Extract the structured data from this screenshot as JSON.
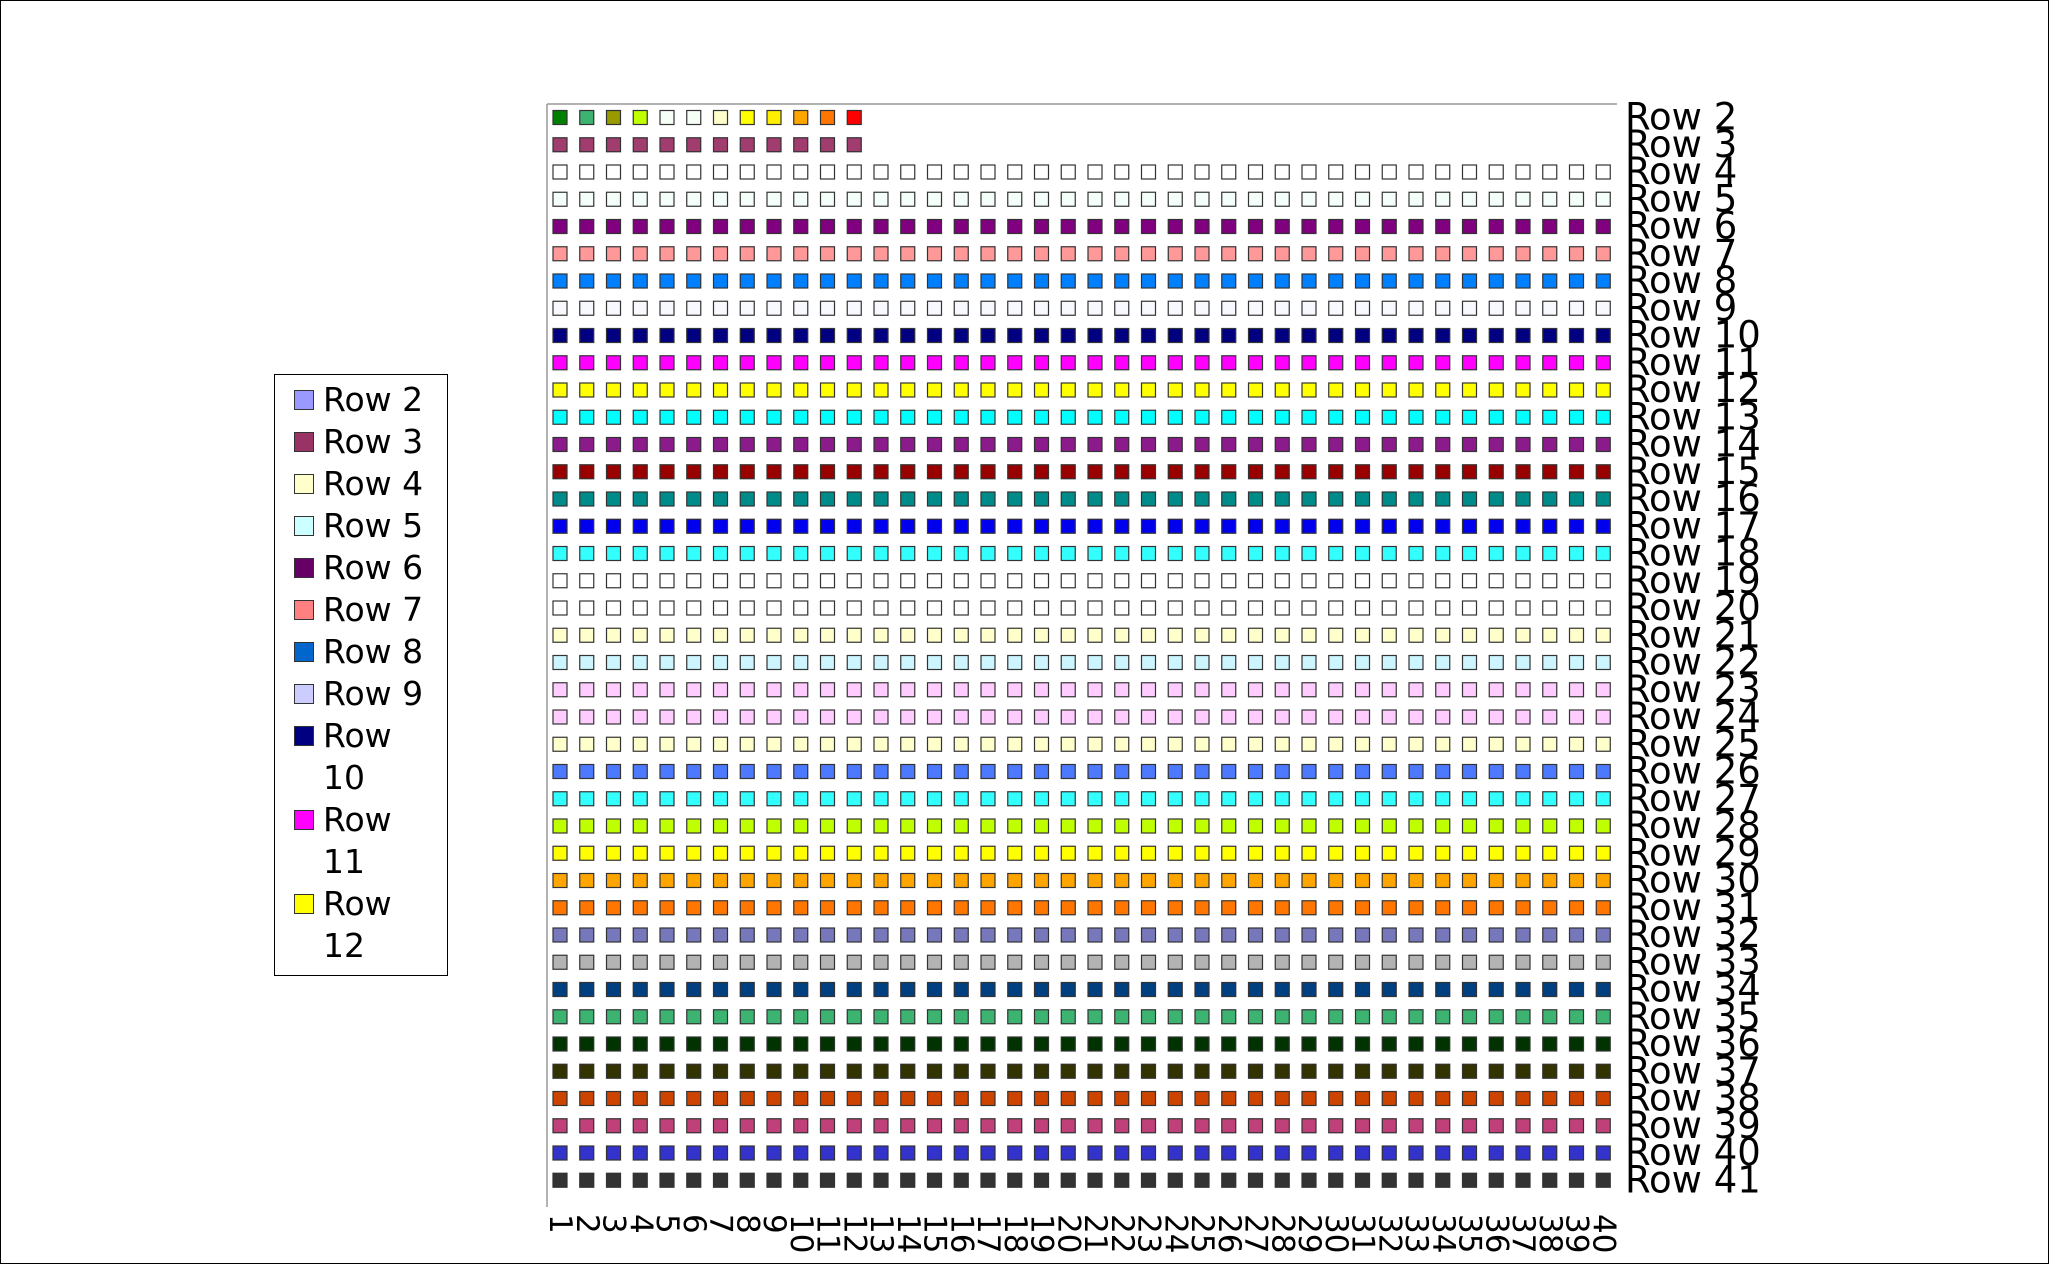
{
  "chart_data": {
    "type": "scatter",
    "description_of_cells": "Grid of colored square markers; each row label has one marker per column index.",
    "x": [
      1,
      2,
      3,
      4,
      5,
      6,
      7,
      8,
      9,
      10,
      11,
      12,
      13,
      14,
      15,
      16,
      17,
      18,
      19,
      20,
      21,
      22,
      23,
      24,
      25,
      26,
      27,
      28,
      29,
      30,
      31,
      32,
      33,
      34,
      35,
      36,
      37,
      38,
      39,
      40
    ],
    "x_tick_labels": [
      "1",
      "2",
      "3",
      "4",
      "5",
      "6",
      "7",
      "8",
      "9",
      "10",
      "11",
      "12",
      "13",
      "14",
      "15",
      "16",
      "17",
      "18",
      "19",
      "20",
      "21",
      "22",
      "23",
      "24",
      "25",
      "26",
      "27",
      "28",
      "29",
      "30",
      "31",
      "32",
      "33",
      "34",
      "35",
      "36",
      "37",
      "38",
      "39",
      "40"
    ],
    "row2_colors": [
      "#008000",
      "#3cb371",
      "#999900",
      "#bfff00",
      "#f5fff5",
      "#f5fff5",
      "#ffffcc",
      "#ffff00",
      "#ffee00",
      "#ffa500",
      "#ff7700",
      "#ff0000"
    ],
    "rows": [
      {
        "label": "Row 2",
        "count": 12,
        "color": "#008000"
      },
      {
        "label": "Row 3",
        "count": 12,
        "color": "#a03c6e"
      },
      {
        "label": "Row 4",
        "count": 40,
        "color": "#ffffff"
      },
      {
        "label": "Row 5",
        "count": 40,
        "color": "#f5fffa"
      },
      {
        "label": "Row 6",
        "count": 40,
        "color": "#800080"
      },
      {
        "label": "Row 7",
        "count": 40,
        "color": "#ff9999"
      },
      {
        "label": "Row 8",
        "count": 40,
        "color": "#0080ff"
      },
      {
        "label": "Row 9",
        "count": 40,
        "color": "#f8f8ff"
      },
      {
        "label": "Row 10",
        "count": 40,
        "color": "#000080"
      },
      {
        "label": "Row 11",
        "count": 40,
        "color": "#ff00ff"
      },
      {
        "label": "Row 12",
        "count": 40,
        "color": "#ffff00"
      },
      {
        "label": "Row 13",
        "count": 40,
        "color": "#00ffff"
      },
      {
        "label": "Row 14",
        "count": 40,
        "color": "#8b1a8b"
      },
      {
        "label": "Row 15",
        "count": 40,
        "color": "#990000"
      },
      {
        "label": "Row 16",
        "count": 40,
        "color": "#008b8b"
      },
      {
        "label": "Row 17",
        "count": 40,
        "color": "#0000ee"
      },
      {
        "label": "Row 18",
        "count": 40,
        "color": "#33ffff"
      },
      {
        "label": "Row 19",
        "count": 40,
        "color": "#ffffff"
      },
      {
        "label": "Row 20",
        "count": 40,
        "color": "#ffffff"
      },
      {
        "label": "Row 21",
        "count": 40,
        "color": "#ffffcc"
      },
      {
        "label": "Row 22",
        "count": 40,
        "color": "#ccf5ff"
      },
      {
        "label": "Row 23",
        "count": 40,
        "color": "#ffccff"
      },
      {
        "label": "Row 24",
        "count": 40,
        "color": "#ffccff"
      },
      {
        "label": "Row 25",
        "count": 40,
        "color": "#ffffcc"
      },
      {
        "label": "Row 26",
        "count": 40,
        "color": "#4d79ff"
      },
      {
        "label": "Row 27",
        "count": 40,
        "color": "#33ffff"
      },
      {
        "label": "Row 28",
        "count": 40,
        "color": "#bfff00"
      },
      {
        "label": "Row 29",
        "count": 40,
        "color": "#ffff00"
      },
      {
        "label": "Row 30",
        "count": 40,
        "color": "#ffa500"
      },
      {
        "label": "Row 31",
        "count": 40,
        "color": "#ff7700"
      },
      {
        "label": "Row 32",
        "count": 40,
        "color": "#7777bb"
      },
      {
        "label": "Row 33",
        "count": 40,
        "color": "#b3b3b3"
      },
      {
        "label": "Row 34",
        "count": 40,
        "color": "#004080"
      },
      {
        "label": "Row 35",
        "count": 40,
        "color": "#3cb371"
      },
      {
        "label": "Row 36",
        "count": 40,
        "color": "#003300"
      },
      {
        "label": "Row 37",
        "count": 40,
        "color": "#333300"
      },
      {
        "label": "Row 38",
        "count": 40,
        "color": "#cc4400"
      },
      {
        "label": "Row 39",
        "count": 40,
        "color": "#c0407a"
      },
      {
        "label": "Row 40",
        "count": 40,
        "color": "#3333cc"
      },
      {
        "label": "Row 41",
        "count": 40,
        "color": "#333333"
      }
    ],
    "legend": {
      "placement": "left",
      "entries": [
        {
          "lines": [
            "Row 2"
          ],
          "color": "#9999ff"
        },
        {
          "lines": [
            "Row 3"
          ],
          "color": "#993366"
        },
        {
          "lines": [
            "Row 4"
          ],
          "color": "#ffffcc"
        },
        {
          "lines": [
            "Row 5"
          ],
          "color": "#ccffff"
        },
        {
          "lines": [
            "Row 6"
          ],
          "color": "#660066"
        },
        {
          "lines": [
            "Row 7"
          ],
          "color": "#ff8080"
        },
        {
          "lines": [
            "Row 8"
          ],
          "color": "#0066cc"
        },
        {
          "lines": [
            "Row 9"
          ],
          "color": "#ccccff"
        },
        {
          "lines": [
            "Row",
            "10"
          ],
          "color": "#000080"
        },
        {
          "lines": [
            "Row",
            "11"
          ],
          "color": "#ff00ff"
        },
        {
          "lines": [
            "Row",
            "12"
          ],
          "color": "#ffff00"
        }
      ]
    },
    "grid": false
  }
}
